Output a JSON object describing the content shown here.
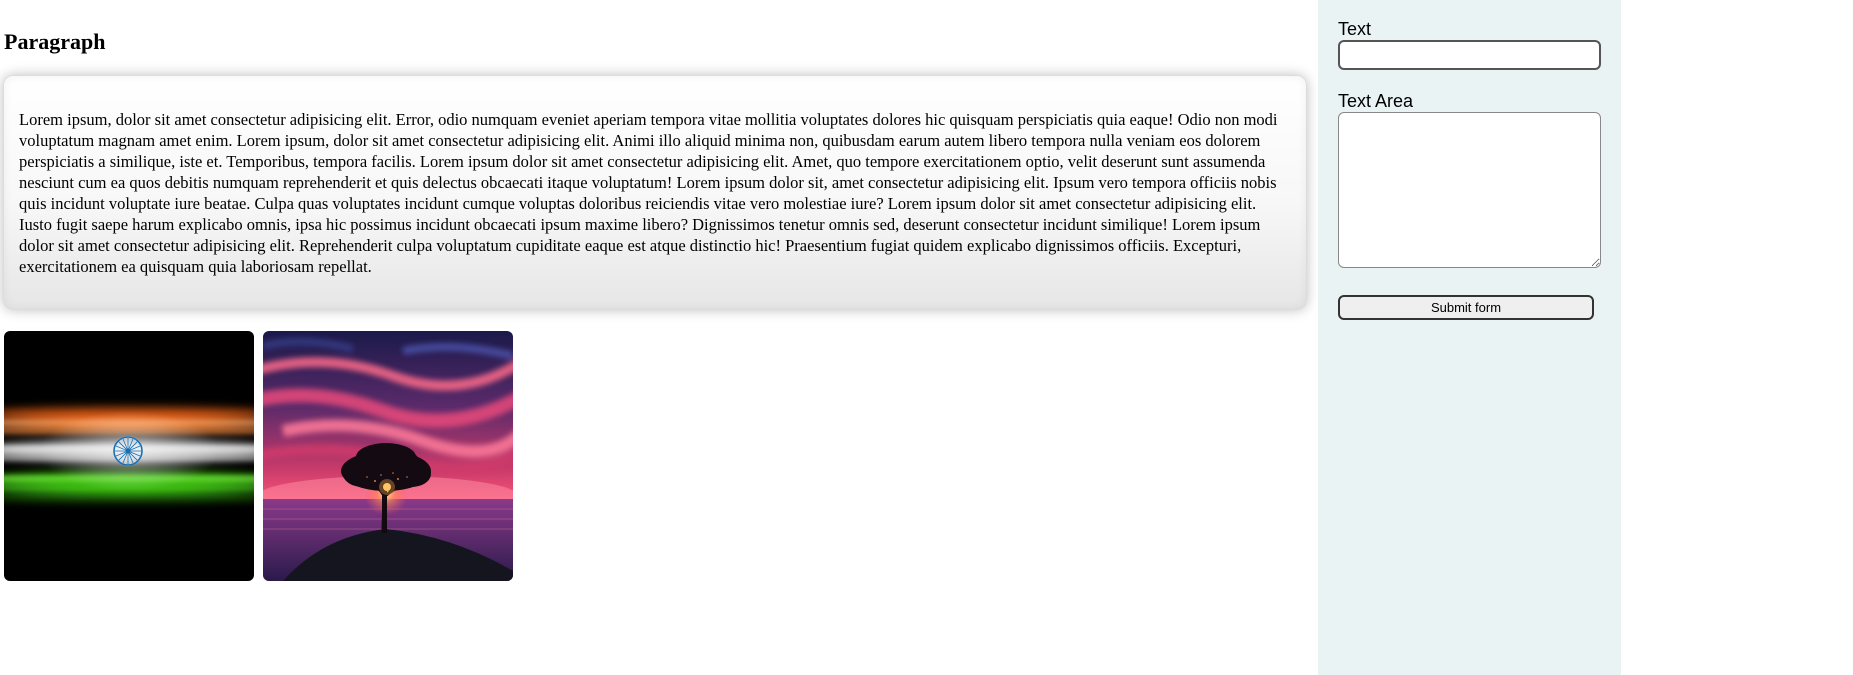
{
  "main": {
    "heading": "Paragraph",
    "paragraph": "Lorem ipsum, dolor sit amet consectetur adipisicing elit. Error, odio numquam eveniet aperiam tempora vitae mollitia voluptates dolores hic quisquam perspiciatis quia eaque! Odio non modi voluptatum magnam amet enim. Lorem ipsum, dolor sit amet consectetur adipisicing elit. Animi illo aliquid minima non, quibusdam earum autem libero tempora nulla veniam eos dolorem perspiciatis a similique, iste et. Temporibus, tempora facilis. Lorem ipsum dolor sit amet consectetur adipisicing elit. Amet, quo tempore exercitationem optio, velit deserunt sunt assumenda nesciunt cum ea quos debitis numquam reprehenderit et quis delectus obcaecati itaque voluptatum! Lorem ipsum dolor sit, amet consectetur adipisicing elit. Ipsum vero tempora officiis nobis quis incidunt voluptate iure beatae. Culpa quas voluptates incidunt cumque voluptas doloribus reiciendis vitae vero molestiae iure? Lorem ipsum dolor sit amet consectetur adipisicing elit. Iusto fugit saepe harum explicabo omnis, ipsa hic possimus incidunt obcaecati ipsum maxime libero? Dignissimos tenetur omnis sed, deserunt consectetur incidunt similique! Lorem ipsum dolor sit amet consectetur adipisicing elit. Reprehenderit culpa voluptatum cupiditate eaque est atque distinctio hic! Praesentium fugiat quidem explicabo dignissimos officiis. Excepturi, exercitationem ea quisquam quia laboriosam repellat.",
    "images": [
      {
        "name": "india-flag-glow-image"
      },
      {
        "name": "tree-sunset-image"
      }
    ]
  },
  "sidebar": {
    "text_label": "Text",
    "text_value": "",
    "textarea_label": "Text Area",
    "textarea_value": "",
    "submit_label": "Submit form"
  },
  "colors": {
    "sidebar_bg": "#e9f3f4",
    "saffron": "#ff7a2a",
    "green": "#4bd61a",
    "chakra_blue": "#1a6fb0"
  }
}
